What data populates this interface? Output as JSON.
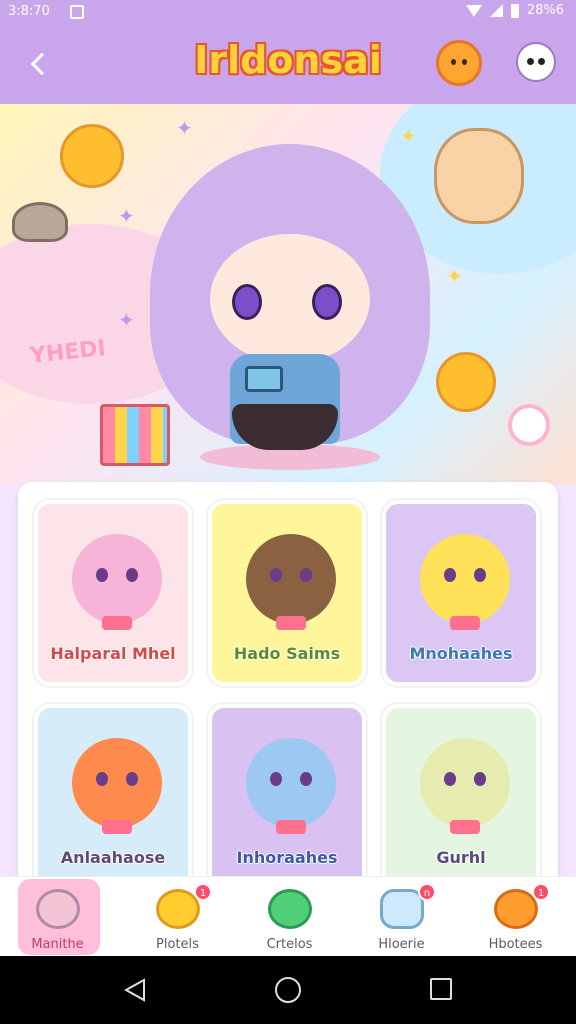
{
  "status_bar": {
    "time": "3:8:70",
    "battery": "28%6"
  },
  "header": {
    "title": "Irldonsai"
  },
  "hero": {
    "caption": "YHEDI"
  },
  "cards": [
    {
      "label": "Halparal Mhel",
      "color": "#d24a4a",
      "bg": "#fde4e8"
    },
    {
      "label": "Hado Saims",
      "color": "#5f8c2a",
      "bg": "#fff59a"
    },
    {
      "label": "Mnohaahes",
      "color": "#3d79b8",
      "bg": "#dcc6f3"
    },
    {
      "label": "Anlaahaose",
      "color": "#5a4b7a",
      "bg": "#d7ecfb"
    },
    {
      "label": "Inhoraahes",
      "color": "#3d5aa8",
      "bg": "#d9c2f1"
    },
    {
      "label": "Gurhl",
      "color": "#5a4b7a",
      "bg": "#e4f6e0"
    }
  ],
  "bottom_nav": [
    {
      "label": "Manithe",
      "icon": "pig-icon",
      "active": true
    },
    {
      "label": "Plotels",
      "icon": "bird-icon",
      "badge": "1"
    },
    {
      "label": "Crtelos",
      "icon": "frog-icon"
    },
    {
      "label": "Hloerie",
      "icon": "ghost-icon",
      "badge": "n"
    },
    {
      "label": "Hbotees",
      "icon": "orange-icon",
      "badge": "1"
    }
  ]
}
